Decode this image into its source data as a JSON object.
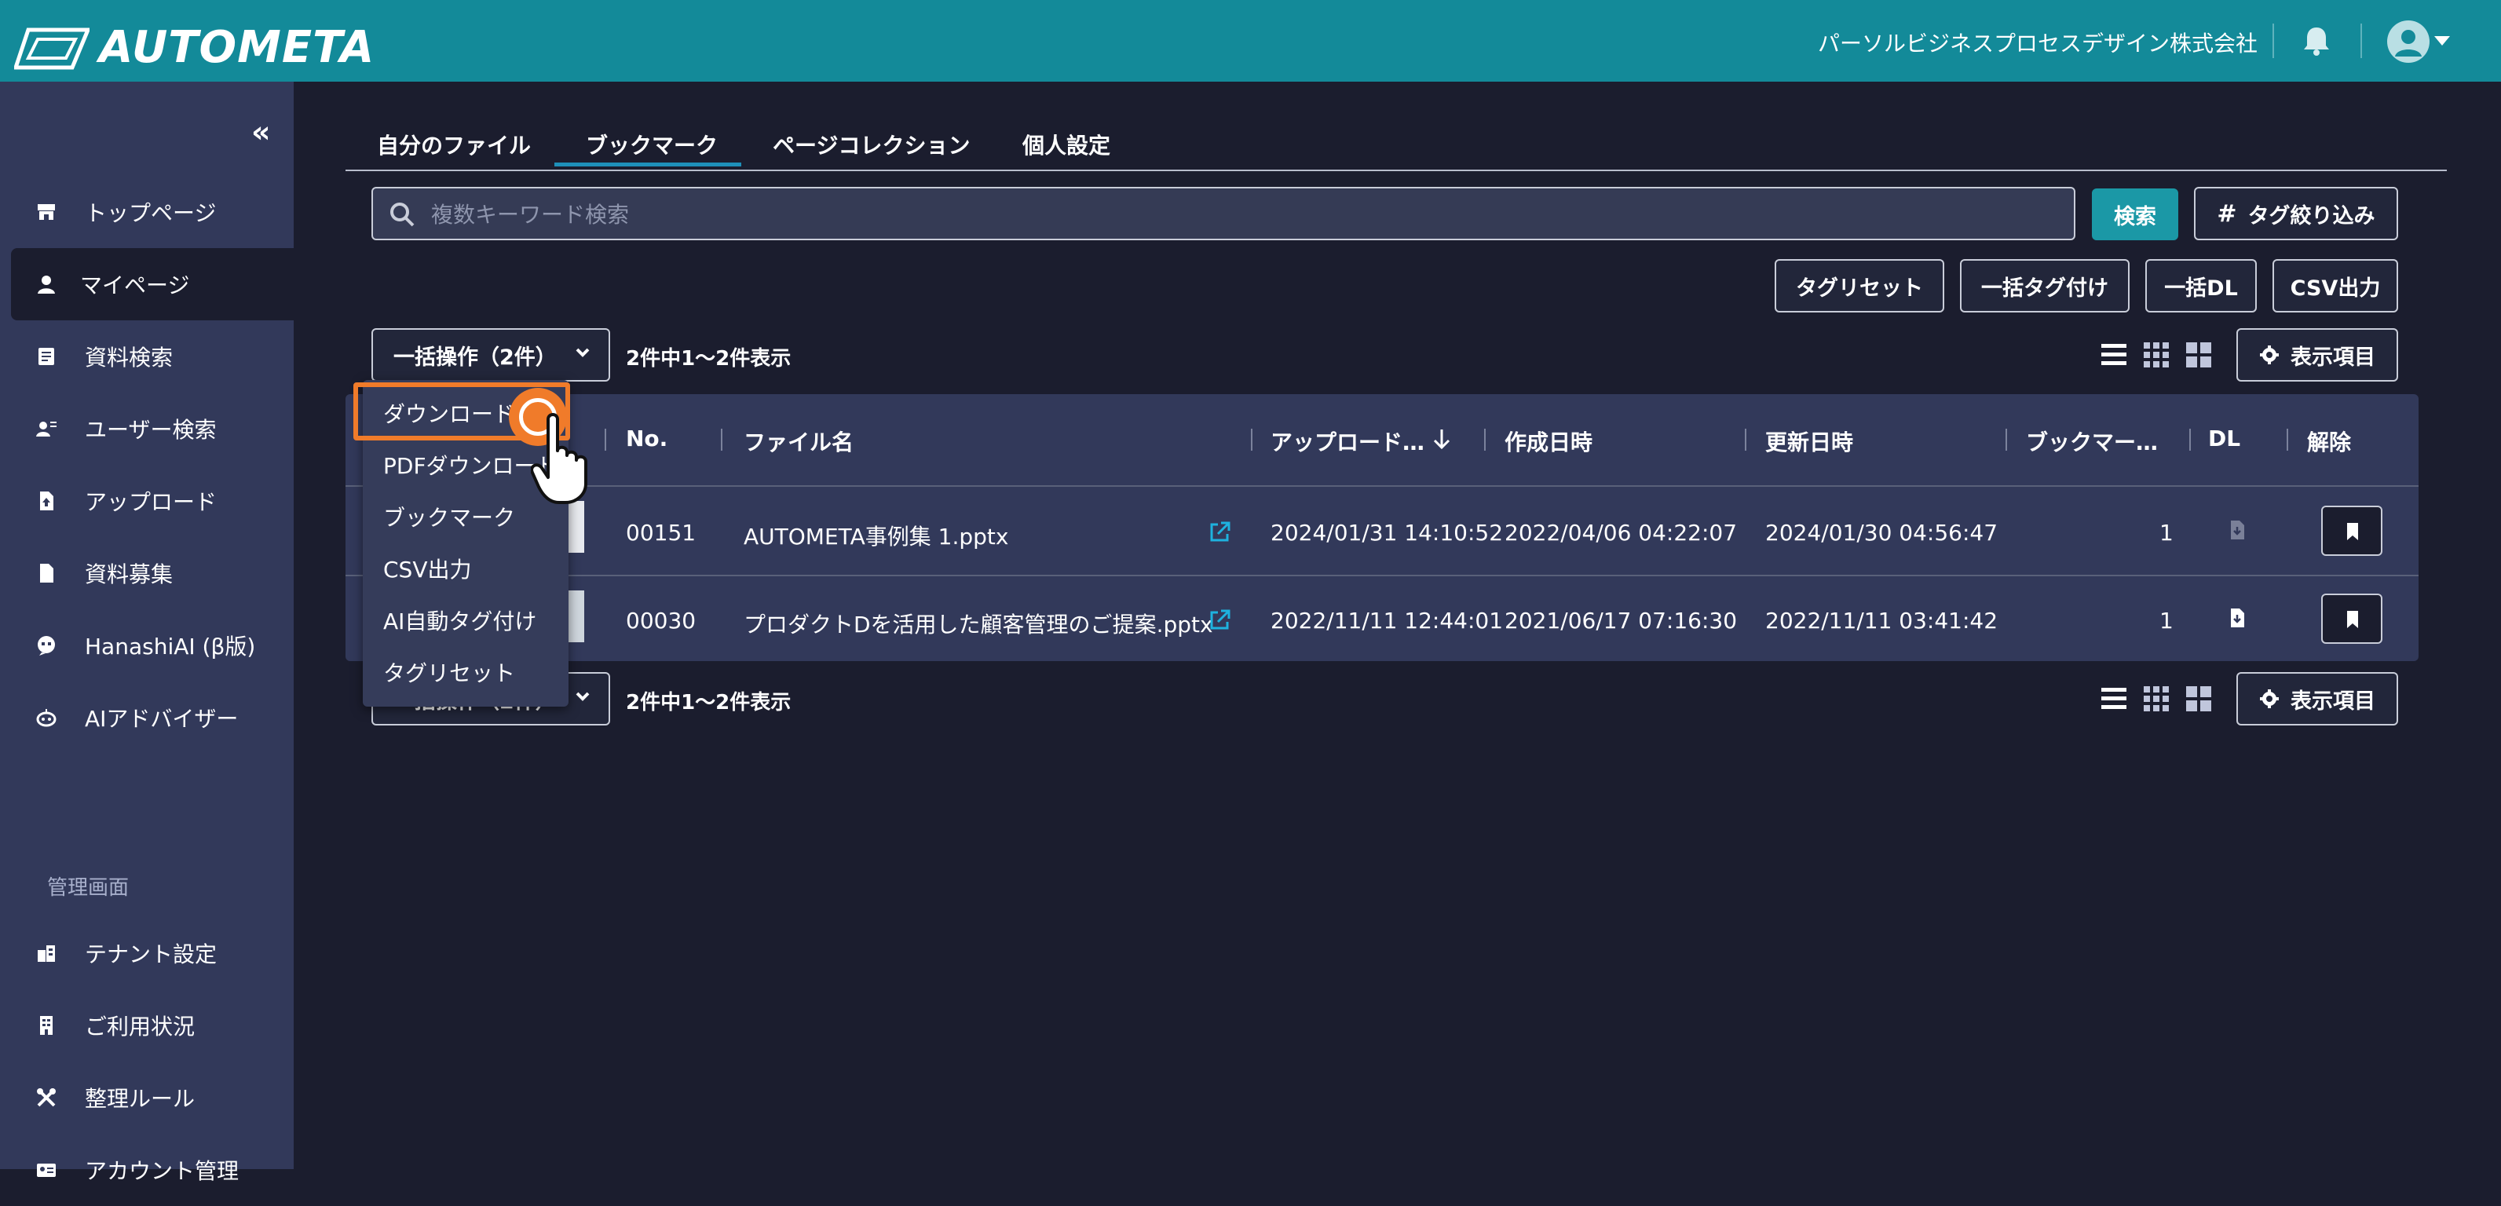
{
  "header": {
    "app_name": "AUTOMETA",
    "company": "パーソルビジネスプロセスデザイン株式会社"
  },
  "sidebar": {
    "items": [
      {
        "label": "トップページ",
        "icon": "store-icon"
      },
      {
        "label": "マイページ",
        "icon": "user-icon",
        "active": true
      },
      {
        "label": "資料検索",
        "icon": "document-search-icon"
      },
      {
        "label": "ユーザー検索",
        "icon": "user-search-icon"
      },
      {
        "label": "アップロード",
        "icon": "file-upload-icon"
      },
      {
        "label": "資料募集",
        "icon": "file-icon"
      },
      {
        "label": "HanashiAI (β版)",
        "icon": "chat-icon"
      },
      {
        "label": "AIアドバイザー",
        "icon": "robot-icon"
      }
    ],
    "admin_section_label": "管理画面",
    "admin_items": [
      {
        "label": "テナント設定",
        "icon": "building-icon"
      },
      {
        "label": "ご利用状況",
        "icon": "office-icon"
      },
      {
        "label": "整理ルール",
        "icon": "tools-icon"
      },
      {
        "label": "アカウント管理",
        "icon": "id-card-icon"
      }
    ]
  },
  "tabs": [
    "自分のファイル",
    "ブックマーク",
    "ページコレクション",
    "個人設定"
  ],
  "active_tab": "ブックマーク",
  "search": {
    "placeholder": "複数キーワード検索",
    "button": "検索",
    "tag_filter": "タグ絞り込み"
  },
  "actions": {
    "tag_reset": "タグリセット",
    "bulk_tag": "一括タグ付け",
    "bulk_dl": "一括DL",
    "csv": "CSV出力"
  },
  "bulk": {
    "label": "一括操作（2件）",
    "count_text": "2件中1〜2件表示",
    "display_items": "表示項目"
  },
  "table": {
    "headers": [
      "No.",
      "ファイル名",
      "アップロード…",
      "作成日時",
      "更新日時",
      "ブックマー…",
      "DL",
      "解除"
    ],
    "rows": [
      {
        "no": "00151",
        "name": "AUTOMETA事例集 1.pptx",
        "uploaded": "2024/01/31 14:10:52",
        "created": "2022/04/06 04:22:07",
        "updated": "2024/01/30 04:56:47",
        "bookmarks": "1",
        "dl_enabled": false
      },
      {
        "no": "00030",
        "name": "プロダクトDを活用した顧客管理のご提案.pptx",
        "uploaded": "2022/11/11 12:44:01",
        "created": "2021/06/17 07:16:30",
        "updated": "2022/11/11 03:41:42",
        "bookmarks": "1",
        "dl_enabled": true
      }
    ]
  },
  "dropdown_menu": [
    "ダウンロード",
    "PDFダウンロード",
    "ブックマーク",
    "CSV出力",
    "AI自動タグ付け",
    "タグリセット"
  ],
  "colors": {
    "header_bg": "#138a99",
    "sidebar_bg": "#32395a",
    "page_bg": "#1b1d2e",
    "primary": "#1b98a6",
    "highlight": "#f07b2a",
    "link": "#1e8fb9"
  }
}
